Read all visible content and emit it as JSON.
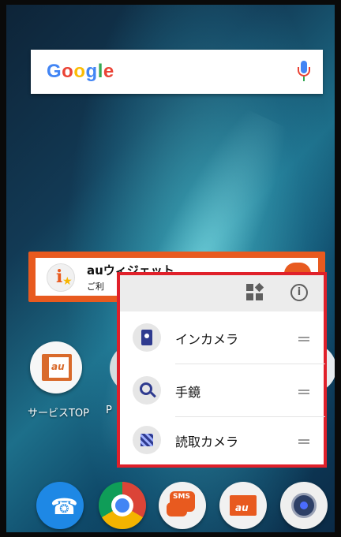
{
  "search": {
    "logo_text": "Google",
    "logo_colors": [
      "#4285f4",
      "#ea4335",
      "#fbbc05",
      "#4285f4",
      "#34a853",
      "#ea4335"
    ],
    "mic_icon": "microphone-icon"
  },
  "widget": {
    "title": "auウィジェット",
    "subtitle": "ご利"
  },
  "apps": {
    "service_top_label": "サービスTOP",
    "p_label": "P"
  },
  "popup": {
    "header_icons": [
      "widgets-icon",
      "info-icon"
    ],
    "info_char": "i",
    "items": [
      {
        "label": "インカメラ",
        "icon": "selfie-camera-icon"
      },
      {
        "label": "手鏡",
        "icon": "hand-mirror-icon"
      },
      {
        "label": "読取カメラ",
        "icon": "qr-scanner-icon"
      }
    ]
  },
  "dock": {
    "items": [
      "phone",
      "chrome",
      "sms",
      "au-mail",
      "camera"
    ],
    "sms_text": "SMS",
    "mail_text": "au"
  },
  "colors": {
    "accent_orange": "#e85a1f",
    "highlight_red": "#e0202a"
  }
}
